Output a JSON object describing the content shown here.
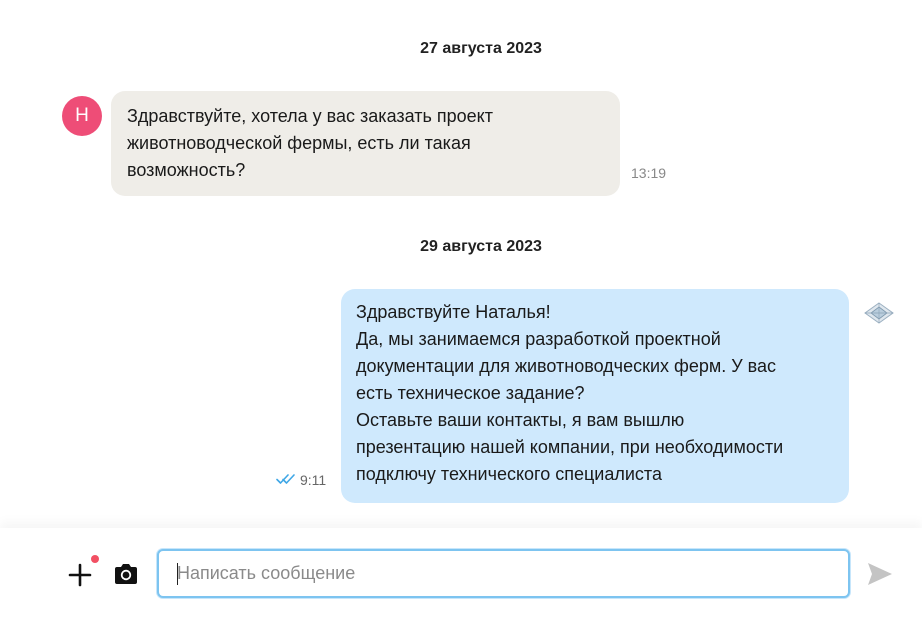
{
  "messages": [
    {
      "date": "27 августа 2023",
      "direction": "incoming",
      "avatar_letter": "Н",
      "lines": [
        "Здравствуйте, хотела у вас заказать проект",
        "животноводческой фермы, есть ли такая",
        "возможность?"
      ],
      "time": "13:19"
    },
    {
      "date": "29 августа 2023",
      "direction": "outgoing",
      "lines": [
        "Здравствуйте Наталья!",
        "Да, мы занимаемся разработкой проектной",
        "документации для животноводческих ферм. У вас",
        "есть техническое задание?",
        "Оставьте ваши контакты, я вам вышлю",
        "презентацию нашей компании, при необходимости",
        "подключу технического специалиста"
      ],
      "time": "9:11",
      "status_icon": "double-check-icon"
    }
  ],
  "composer": {
    "placeholder": "Написать сообщение",
    "value": "",
    "attach_icon": "plus-icon",
    "camera_icon": "camera-icon",
    "send_icon": "send-icon"
  },
  "colors": {
    "avatar": "#ee4d77",
    "incoming_bubble": "#efede8",
    "outgoing_bubble": "#cfe9fd",
    "input_border": "#7dc4f0",
    "read_ticks": "#3fa7e6",
    "notification_dot": "#f25063"
  }
}
